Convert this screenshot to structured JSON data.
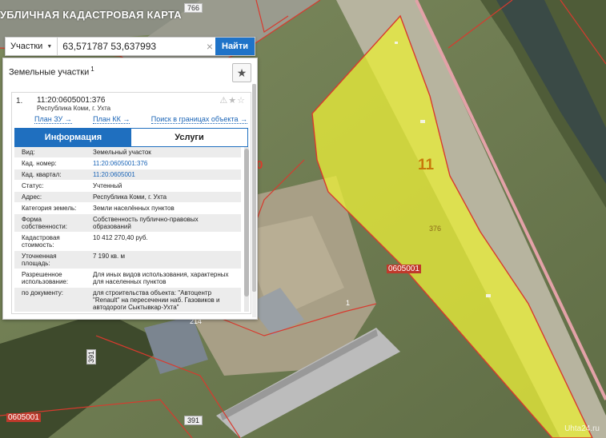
{
  "map": {
    "title": "УБЛИЧНАЯ КАДАСТРОВАЯ КАРТА",
    "labels": {
      "l766": "766",
      "l0": "0",
      "l11": "11",
      "l376": "376",
      "l1": "1",
      "l214": "214",
      "l391a": "391",
      "l391b": "391",
      "quarter1": "0605001",
      "quarter2": "0605001"
    },
    "watermark": "Uhta24.ru",
    "colors": {
      "parcel_fill": "#e8ec3a",
      "parcel_border": "#d83a2e"
    }
  },
  "search": {
    "type_label": "Участки",
    "value": "63,571787 53,637993",
    "clear_icon": "×",
    "button": "Найти"
  },
  "panel": {
    "title": "Земельные участки",
    "count": "1",
    "star_icon": "★",
    "result": {
      "num": "1.",
      "id": "11:20:0605001:376",
      "address": "Республика Коми, г. Ухта",
      "icons": "⚠★☆",
      "links": {
        "plan_zu": "План ЗУ →",
        "plan_kk": "План КК →",
        "search_bounds": "Поиск в границах объекта →"
      },
      "tabs": {
        "info": "Информация",
        "services": "Услуги"
      },
      "rows": [
        {
          "k": "Вид:",
          "v": "Земельный участок"
        },
        {
          "k": "Кад. номер:",
          "v": "11:20:0605001:376"
        },
        {
          "k": "Кад. квартал:",
          "v": "11:20:0605001"
        },
        {
          "k": "Статус:",
          "v": "Учтенный"
        },
        {
          "k": "Адрес:",
          "v": "Республика Коми, г. Ухта"
        },
        {
          "k": "Категория земель:",
          "v": "Земли населённых пунктов"
        },
        {
          "k": "Форма собственности:",
          "v": "Собственность публично-правовых образований"
        },
        {
          "k": "Кадастровая стоимость:",
          "v": "10 412 270,40 руб."
        },
        {
          "k": "Уточненная площадь:",
          "v": "7 190 кв. м"
        },
        {
          "k": "Разрешенное использование:",
          "v": "Для иных видов использования, характерных для населенных пунктов"
        },
        {
          "k": "по документу:",
          "v": "для строительства объекта: \"Автоцентр \"Renault\" на пересечении наб. Газовиков и автодороги Сыктывкар-Ухта\""
        }
      ]
    }
  }
}
